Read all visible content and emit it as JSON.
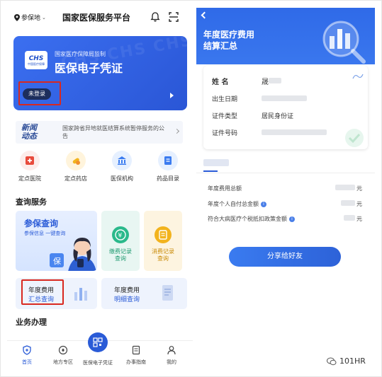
{
  "left": {
    "location": "参保地",
    "app_title": "国家医保服务平台",
    "hero": {
      "supervised": "国家医疗保障局监制",
      "title": "医保电子凭证",
      "logo_text": "CHS",
      "logo_sub": "中国医疗保障",
      "login_label": "未登录"
    },
    "news": {
      "tag_line1": "新闻",
      "tag_line2": "动态",
      "text": "国家跨省异地就医结算系统暂停服务的公告"
    },
    "quick": [
      {
        "label": "定点医院",
        "icon": "hospital-icon"
      },
      {
        "label": "定点药店",
        "icon": "pharmacy-icon"
      },
      {
        "label": "医保机构",
        "icon": "institution-icon"
      },
      {
        "label": "药品目录",
        "icon": "catalog-icon"
      }
    ],
    "query_section": "查询服务",
    "insured_query": {
      "title": "参保查询",
      "sub": "参保信息 一键查询"
    },
    "payment_record": {
      "line1": "缴费记录",
      "line2": "查询"
    },
    "consume_record": {
      "line1": "消费记录",
      "line2": "查询"
    },
    "annual_summary": {
      "line1": "年度费用",
      "line2": "汇总查询"
    },
    "annual_detail": {
      "line1": "年度费用",
      "line2": "明细查询"
    },
    "business_section": "业务办理",
    "tabs": [
      {
        "label": "首页",
        "icon": "home-shield-icon"
      },
      {
        "label": "地方专区",
        "icon": "region-icon"
      },
      {
        "label": "医保电子凭证",
        "icon": "qr-code-icon"
      },
      {
        "label": "办事指南",
        "icon": "guide-icon"
      },
      {
        "label": "我的",
        "icon": "profile-icon"
      }
    ]
  },
  "right": {
    "title_line1": "年度医疗费用",
    "title_line2": "结算汇总",
    "fields": [
      {
        "label": "姓 名",
        "value": "晟"
      },
      {
        "label": "出生日期",
        "value": ""
      },
      {
        "label": "证件类型",
        "value": "居民身份证"
      },
      {
        "label": "证件号码",
        "value": ""
      }
    ],
    "summary": [
      {
        "label": "年度费用总额",
        "unit": "元",
        "info": false
      },
      {
        "label": "年度个人自付总金额",
        "unit": "元",
        "info": true
      },
      {
        "label": "符合大病医疗个税抵扣政策金额",
        "unit": "元",
        "info": true
      }
    ],
    "share_label": "分享给好友",
    "info_glyph": "i"
  },
  "watermark": "101HR",
  "colors": {
    "accent": "#2a5bd7",
    "highlight": "#d9281f"
  }
}
